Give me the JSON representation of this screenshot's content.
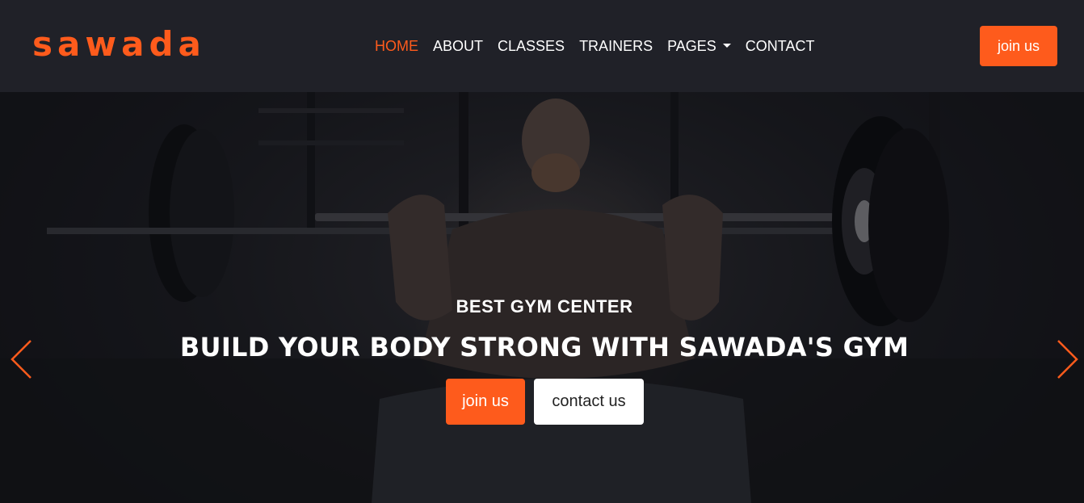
{
  "brand": {
    "name": "sawada"
  },
  "nav": {
    "items": [
      {
        "label": "HOME",
        "active": true
      },
      {
        "label": "ABOUT",
        "active": false
      },
      {
        "label": "CLASSES",
        "active": false
      },
      {
        "label": "TRAINERS",
        "active": false
      },
      {
        "label": "PAGES",
        "active": false,
        "dropdown": true
      },
      {
        "label": "CONTACT",
        "active": false
      }
    ],
    "join_label": "join us"
  },
  "hero": {
    "subtitle": "BEST GYM CENTER",
    "title": "BUILD YOUR BODY STRONG WITH SAWADA'S GYM",
    "primary_button": "join us",
    "secondary_button": "contact us",
    "prev_icon": "chevron-left-icon",
    "next_icon": "chevron-right-icon"
  },
  "colors": {
    "accent": "#fe5b1c",
    "navbar_bg": "#202128",
    "text": "#ffffff"
  }
}
